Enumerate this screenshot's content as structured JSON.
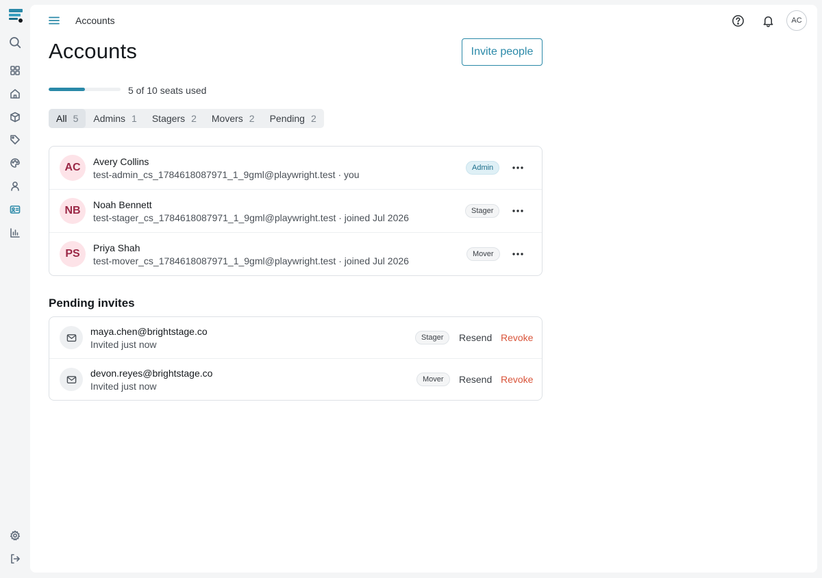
{
  "topbar": {
    "breadcrumb": "Accounts",
    "avatar_initials": "AC"
  },
  "page": {
    "title": "Accounts",
    "invite_button": "Invite people"
  },
  "seats": {
    "used": 5,
    "total": 10,
    "fraction": 0.5,
    "label": "5 of 10 seats used"
  },
  "filters": [
    {
      "label": "All",
      "count": "5",
      "active": true
    },
    {
      "label": "Admins",
      "count": "1",
      "active": false
    },
    {
      "label": "Stagers",
      "count": "2",
      "active": false
    },
    {
      "label": "Movers",
      "count": "2",
      "active": false
    },
    {
      "label": "Pending",
      "count": "2",
      "active": false
    }
  ],
  "members": [
    {
      "initials": "AC",
      "name": "Avery Collins",
      "detail": "test-admin_cs_1784618087971_1_9gml@playwright.test · you",
      "role": "Admin"
    },
    {
      "initials": "NB",
      "name": "Noah Bennett",
      "detail": "test-stager_cs_1784618087971_1_9gml@playwright.test · joined Jul 2026",
      "role": "Stager"
    },
    {
      "initials": "PS",
      "name": "Priya Shah",
      "detail": "test-mover_cs_1784618087971_1_9gml@playwright.test · joined Jul 2026",
      "role": "Mover"
    }
  ],
  "pending": {
    "title": "Pending invites",
    "invites": [
      {
        "email": "maya.chen@brightstage.co",
        "status": "Invited just now",
        "role": "Stager",
        "resend": "Resend",
        "revoke": "Revoke"
      },
      {
        "email": "devon.reyes@brightstage.co",
        "status": "Invited just now",
        "role": "Mover",
        "resend": "Resend",
        "revoke": "Revoke"
      }
    ]
  },
  "colors": {
    "accent": "#2a89a8",
    "danger": "#d9543a",
    "avatar_bg": "#fde3e8",
    "avatar_text": "#9b2846"
  },
  "icons": {
    "sidebar": [
      "logo-icon",
      "search-icon",
      "dashboard-icon",
      "home-icon",
      "box-icon",
      "tag-icon",
      "palette-icon",
      "user-icon",
      "id-card-icon",
      "bar-chart-icon",
      "settings-icon",
      "logout-icon"
    ],
    "topbar": [
      "menu-icon",
      "help-icon",
      "bell-icon"
    ]
  }
}
